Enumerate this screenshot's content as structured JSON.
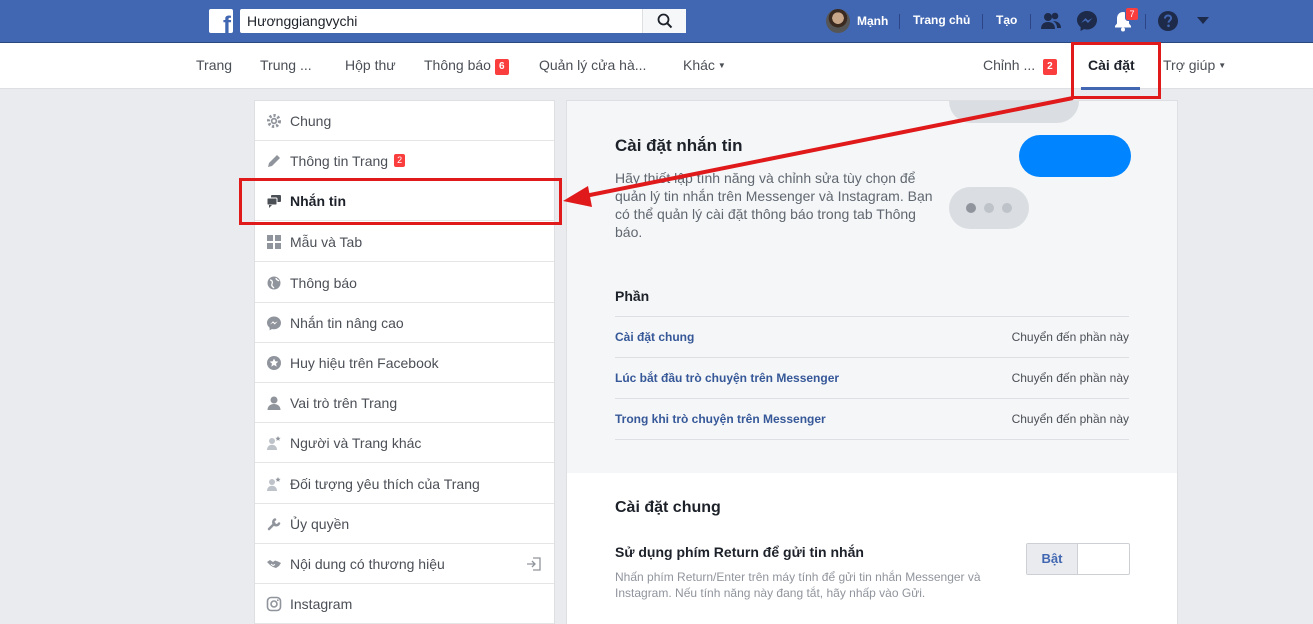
{
  "topbar": {
    "logo": "f",
    "search_value": "Hươnggiangvychi",
    "user_name": "Mạnh",
    "home": "Trang chủ",
    "create": "Tạo",
    "notif_count": "7"
  },
  "page_nav": {
    "items": [
      "Trang",
      "Trung ...",
      "Hộp thư",
      "Thông báo",
      "Quản lý cửa hà...",
      "Khác"
    ],
    "notif_badge": "6",
    "edit": "Chỉnh ...",
    "edit_badge": "2",
    "settings": "Cài đặt",
    "help": "Trợ giúp",
    "caret": "▼"
  },
  "sidebar": {
    "items": [
      {
        "label": "Chung",
        "icon": "gear-icon"
      },
      {
        "label": "Thông tin Trang",
        "icon": "pencil-icon",
        "badge": "2"
      },
      {
        "label": "Nhắn tin",
        "icon": "messages-icon"
      },
      {
        "label": "Mẫu và Tab",
        "icon": "grid-icon"
      },
      {
        "label": "Thông báo",
        "icon": "globe-icon"
      },
      {
        "label": "Nhắn tin nâng cao",
        "icon": "messenger-icon"
      },
      {
        "label": "Huy hiệu trên Facebook",
        "icon": "star-badge-icon"
      },
      {
        "label": "Vai trò trên Trang",
        "icon": "person-icon"
      },
      {
        "label": "Người và Trang khác",
        "icon": "person-star-icon"
      },
      {
        "label": "Đối tượng yêu thích của Trang",
        "icon": "person-star-icon"
      },
      {
        "label": "Ủy quyền",
        "icon": "wrench-icon"
      },
      {
        "label": "Nội dung có thương hiệu",
        "icon": "handshake-icon"
      },
      {
        "label": "Instagram",
        "icon": "instagram-icon"
      }
    ]
  },
  "main": {
    "title": "Cài đặt nhắn tin",
    "description": "Hãy thiết lập tính năng và chỉnh sửa tùy chọn để quản lý tin nhắn trên Messenger và Instagram. Bạn có thể quản lý cài đặt thông báo trong tab Thông báo.",
    "sections_label": "Phần",
    "sections": [
      {
        "name": "Cài đặt chung",
        "action": "Chuyển đến phần này"
      },
      {
        "name": "Lúc bắt đầu trò chuyện trên Messenger",
        "action": "Chuyển đến phần này"
      },
      {
        "name": "Trong khi trò chuyện trên Messenger",
        "action": "Chuyển đến phần này"
      }
    ],
    "general_title": "Cài đặt chung",
    "option_title": "Sử dụng phím Return để gửi tin nhắn",
    "option_desc": "Nhấn phím Return/Enter trên máy tính để gửi tin nhắn Messenger và Instagram. Nếu tính năng này đang tắt, hãy nhấp vào Gửi.",
    "toggle_on": "Bật"
  },
  "colors": {
    "brand": "#4267b2",
    "annotation": "#e0191b",
    "messenger_blue": "#0084ff"
  }
}
